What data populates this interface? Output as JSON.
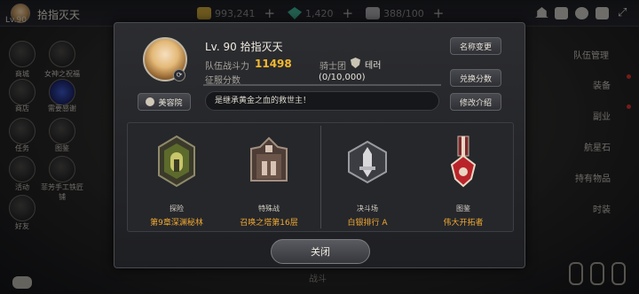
{
  "topbar": {
    "player_name": "拾指灭天",
    "level": "Lv.90",
    "resources": [
      {
        "name": "gold",
        "value": "993,241",
        "color": "#c9a23a",
        "icon": "coin-icon"
      },
      {
        "name": "gems",
        "value": "1,420",
        "color": "#3fae8e",
        "icon": "gem-icon"
      },
      {
        "name": "stamina",
        "value": "388/100",
        "color": "#a8a8ad",
        "icon": "energy-icon"
      }
    ],
    "system_icons": [
      "bell-icon",
      "chat-icon",
      "gear-icon",
      "mail-icon"
    ]
  },
  "left_menu": [
    {
      "label": "商城",
      "icon": "shop-icon"
    },
    {
      "label": "女神之祝福",
      "icon": "goddess-icon"
    },
    {
      "label": "商店",
      "icon": "store-icon"
    },
    {
      "label": "需要感谢",
      "icon": "portal-icon"
    },
    {
      "label": "任务",
      "icon": "quest-icon"
    },
    {
      "label": "图鉴",
      "icon": "codex-icon"
    },
    {
      "label": "活动",
      "icon": "event-icon"
    },
    {
      "label": "菲芳手工铁匠铺",
      "icon": "smith-icon"
    },
    {
      "label": "好友",
      "icon": "friend-icon"
    }
  ],
  "right_menu": [
    "队伍管理",
    "装备",
    "副业",
    "航星石",
    "持有物品",
    "时装"
  ],
  "bottom_text": "战斗",
  "profile": {
    "name": "Lv. 90 拾指灭天",
    "power_label": "队伍战斗力",
    "power": "11498",
    "guild_label": "骑士团",
    "guild": "테러",
    "score_label": "征服分数",
    "score": "(0/10,000)",
    "score_progress": 0,
    "motto": "是继承黄金之血的救世主！",
    "buttons": {
      "rename": "名称变更",
      "exchange": "兑换分数",
      "edit_intro": "修改介绍",
      "beauty": "美容院",
      "close": "关闭"
    }
  },
  "achievements": [
    {
      "category": "探险",
      "value": "第9章深渊秘林",
      "emblem": "adventure-emblem"
    },
    {
      "category": "特殊战",
      "value": "召唤之塔第16层",
      "emblem": "special-battle-emblem"
    },
    {
      "category": "决斗场",
      "value": "白银排行 A",
      "emblem": "arena-emblem"
    },
    {
      "category": "图鉴",
      "value": "伟大开拓者",
      "emblem": "codex-medal-emblem"
    }
  ]
}
